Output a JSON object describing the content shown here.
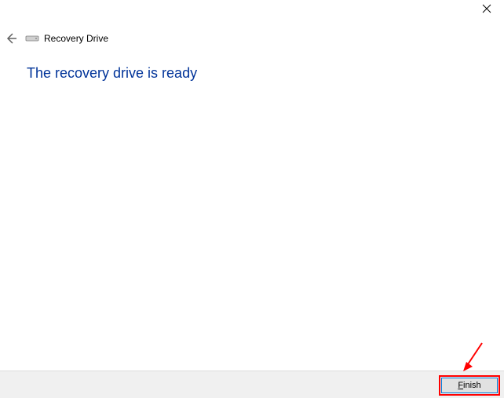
{
  "window": {
    "title": "Recovery Drive"
  },
  "content": {
    "heading": "The recovery drive is ready"
  },
  "buttons": {
    "finish": "Finish"
  }
}
